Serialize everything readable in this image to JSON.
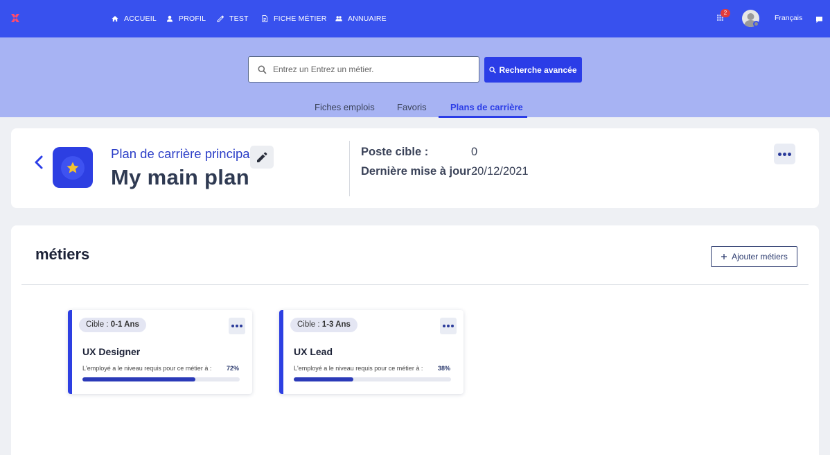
{
  "colors": {
    "brand": "#3851ee",
    "accent": "#2b3de7",
    "band": "#a7b3f3",
    "star": "#f2c230"
  },
  "nav": {
    "logo_icon": "app-logo-icon",
    "items": [
      {
        "label": "ACCUEIL",
        "icon": "home-icon"
      },
      {
        "label": "PROFIL",
        "icon": "user-icon"
      },
      {
        "label": "TEST",
        "icon": "edit-icon"
      },
      {
        "label": "FICHE MÉTIER",
        "icon": "document-icon"
      },
      {
        "label": "ANNUAIRE",
        "icon": "users-icon"
      }
    ],
    "notifications_count": "2",
    "language": "Français"
  },
  "search": {
    "placeholder": "Entrez un Entrez un métier.",
    "advanced_label": "Recherche avancée"
  },
  "tabs": [
    {
      "label": "Fiches emplois",
      "active": false
    },
    {
      "label": "Favoris",
      "active": false
    },
    {
      "label": "Plans de carrière",
      "active": true
    }
  ],
  "plan": {
    "subtitle": "Plan de carrière principal",
    "name": "My main plan",
    "target_label": "Poste cible :",
    "target_value": "0",
    "updated_label": "Dernière mise à jour :",
    "updated_value": "20/12/2021"
  },
  "metiers": {
    "title": "métiers",
    "add_label": "Ajouter métiers",
    "jobs": [
      {
        "cible_prefix": "Cible : ",
        "cible_range": "0-1 Ans",
        "title": "UX Designer",
        "description": "L'employé a le niveau requis pour ce métier à :",
        "percent": "72%",
        "progress": 0.72
      },
      {
        "cible_prefix": "Cible : ",
        "cible_range": "1-3 Ans",
        "title": "UX Lead",
        "description": "L'employé a le niveau requis pour ce métier à :",
        "percent": "38%",
        "progress": 0.38
      }
    ]
  }
}
